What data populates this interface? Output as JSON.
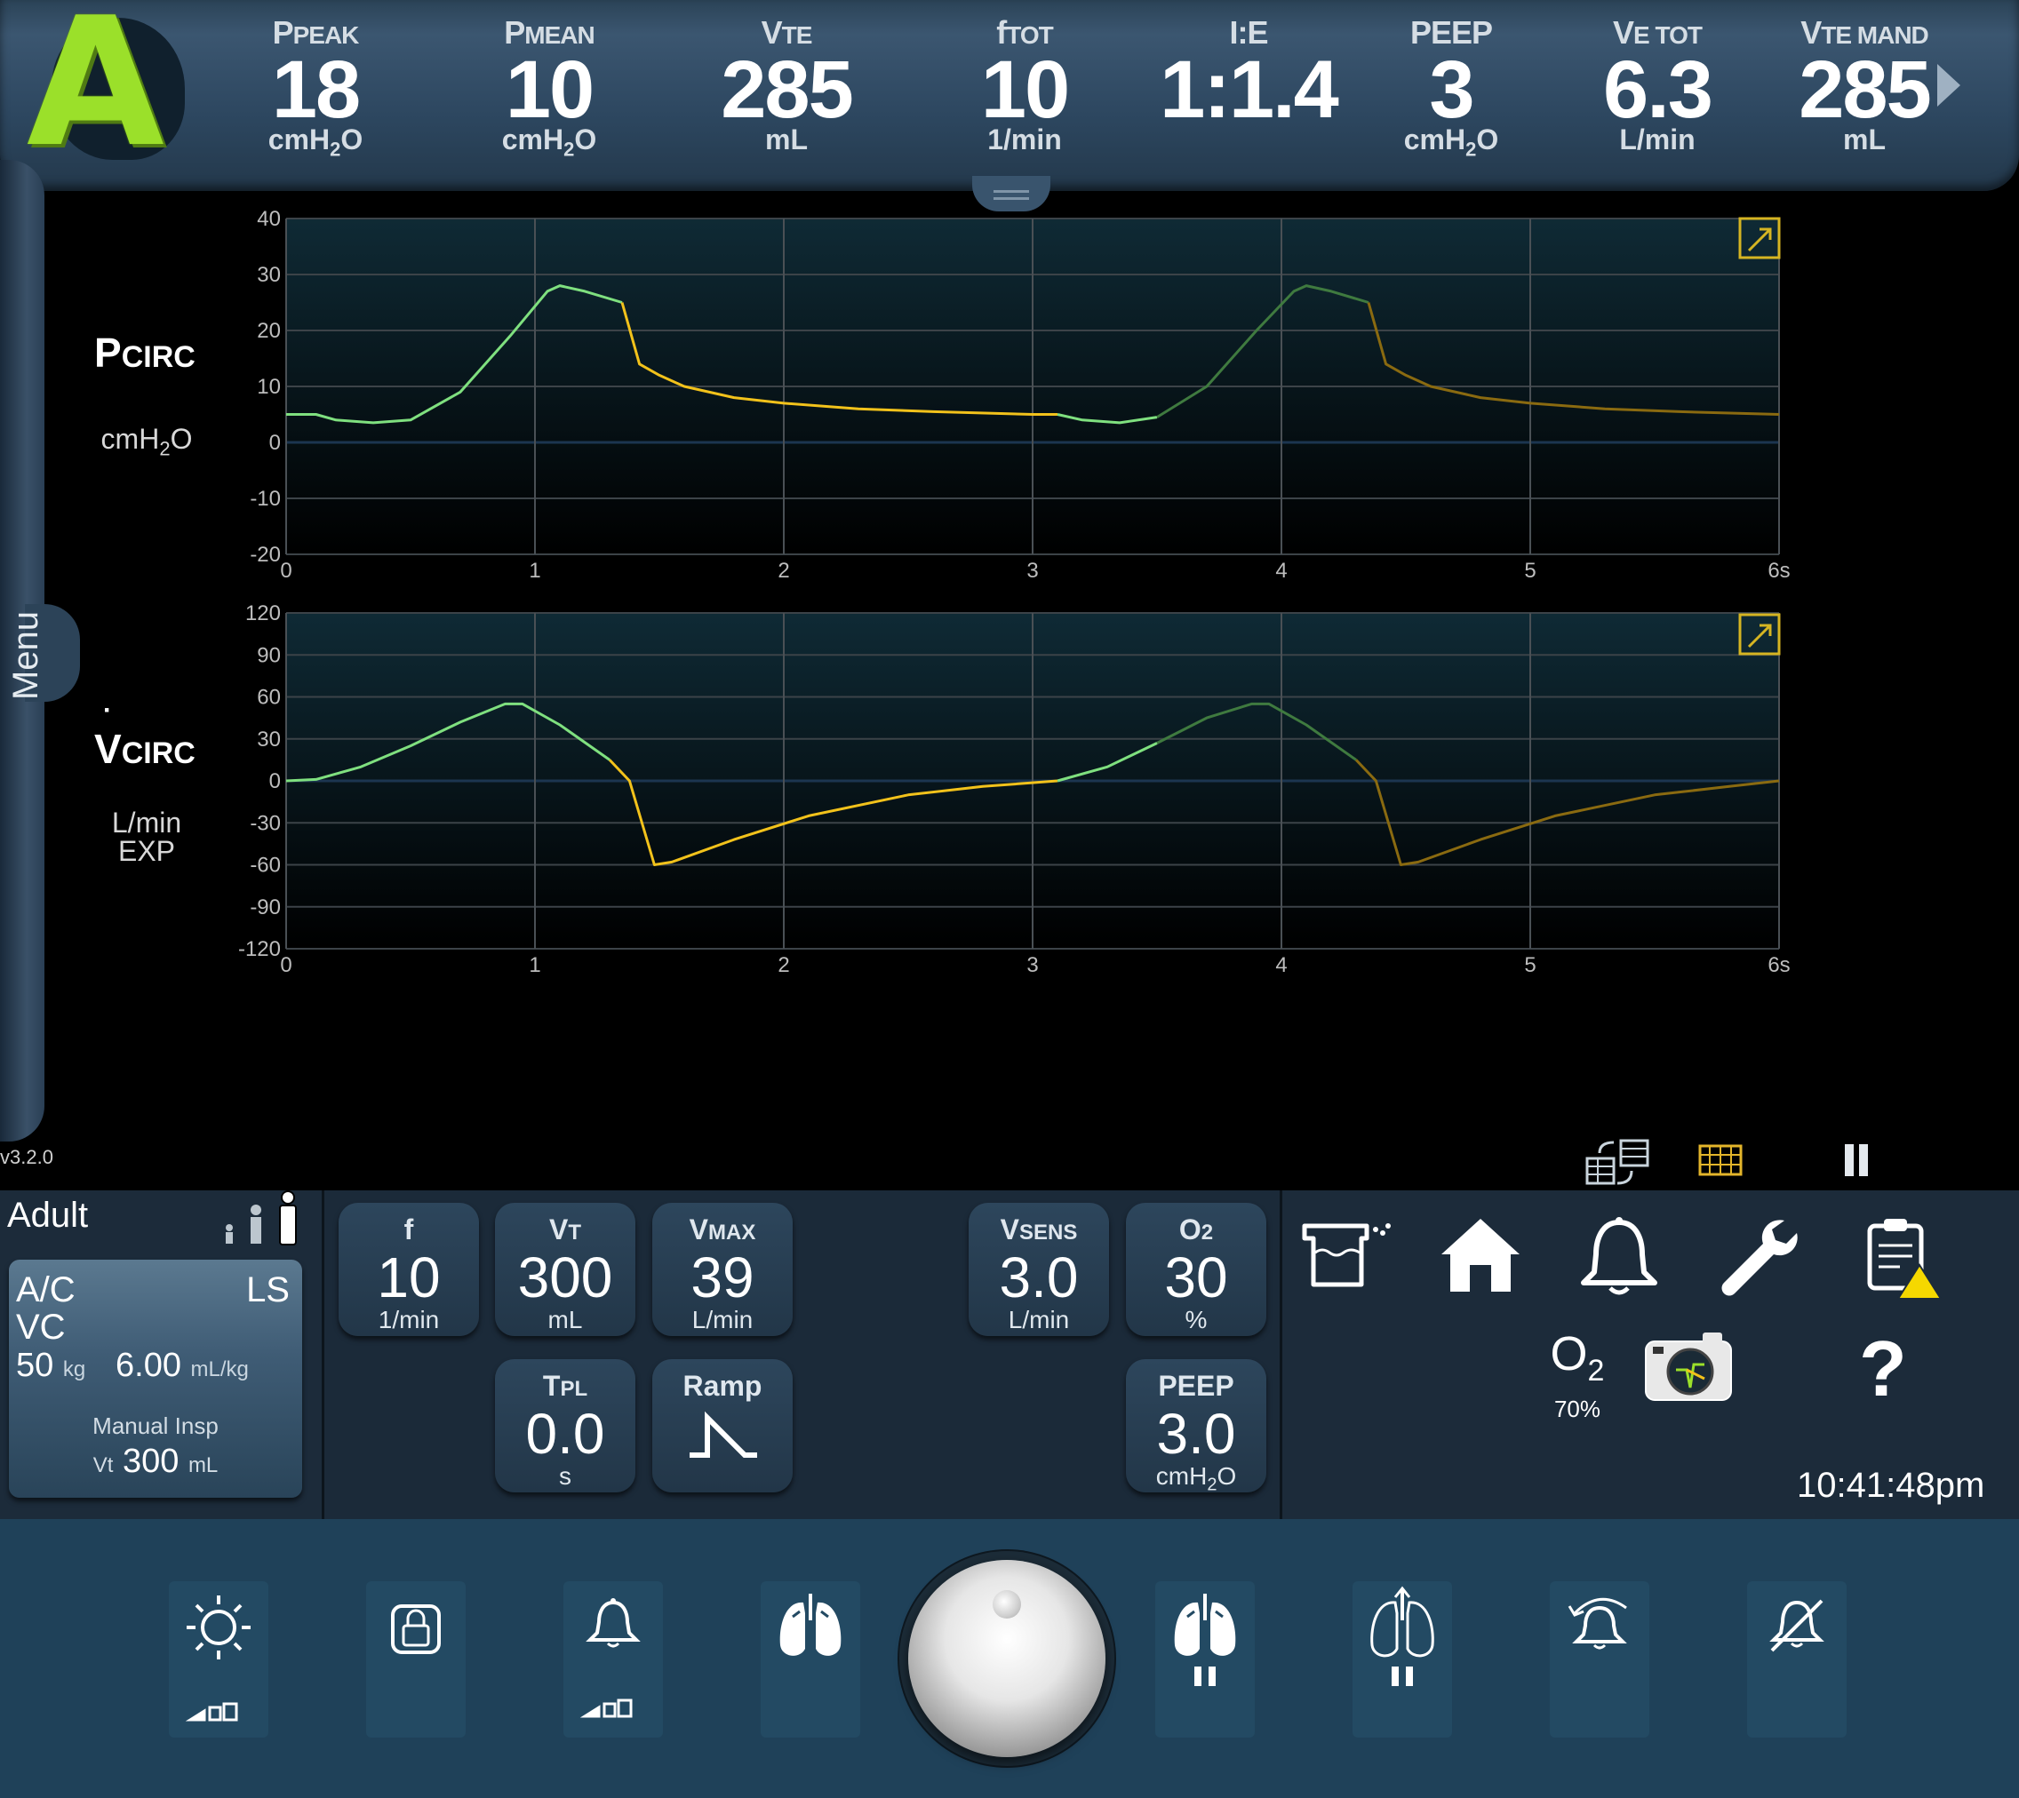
{
  "mode_letter": "A",
  "monitored": [
    {
      "main": "P",
      "sub": "PEAK",
      "value": "18",
      "unit": "cmH",
      "unit_sub": "2",
      "unit_tail": "O"
    },
    {
      "main": "P",
      "sub": "MEAN",
      "value": "10",
      "unit": "cmH",
      "unit_sub": "2",
      "unit_tail": "O"
    },
    {
      "main": "V",
      "sub": "TE",
      "value": "285",
      "unit": "mL",
      "unit_sub": "",
      "unit_tail": ""
    },
    {
      "main": "f",
      "sub": "TOT",
      "value": "10",
      "unit": "1/min",
      "unit_sub": "",
      "unit_tail": ""
    },
    {
      "main": "I:E",
      "sub": "",
      "value": "1:1.4",
      "unit": "",
      "unit_sub": "",
      "unit_tail": ""
    },
    {
      "main": "PEEP",
      "sub": "",
      "value": "3",
      "unit": "cmH",
      "unit_sub": "2",
      "unit_tail": "O"
    },
    {
      "main": "V",
      "sub": "E TOT",
      "value": "6.3",
      "unit": "L/min",
      "unit_sub": "",
      "unit_tail": ""
    },
    {
      "main": "V",
      "sub": "TE MAND",
      "value": "285",
      "unit": "mL",
      "unit_sub": "",
      "unit_tail": ""
    }
  ],
  "menu_label": "Menu",
  "version": "v3.2.0",
  "waveforms": {
    "pressure": {
      "label_main": "P",
      "label_sub": "CIRC",
      "unit_main": "cmH",
      "unit_sub": "2",
      "unit_tail": "O"
    },
    "flow": {
      "label_main": "V",
      "label_sub": "CIRC",
      "unit_line1": "L/min",
      "unit_line2": "EXP"
    }
  },
  "chart_data": [
    {
      "type": "line",
      "name": "pressure",
      "ylim": [
        -20,
        40
      ],
      "yticks": [
        "40",
        "30",
        "20",
        "10",
        "0",
        "-10",
        "-20"
      ],
      "xlim": [
        0,
        6
      ],
      "xticks": [
        "0",
        "1",
        "2",
        "3",
        "4",
        "5",
        "6s"
      ],
      "series": [
        {
          "phase": "insp",
          "x": [
            0,
            0.12,
            0.2,
            0.35,
            0.5,
            0.7,
            0.9,
            1.05,
            1.1,
            1.2,
            1.35
          ],
          "y": [
            5,
            5,
            4,
            3.5,
            4,
            9,
            19,
            27,
            28,
            27,
            25
          ]
        },
        {
          "phase": "exp",
          "x": [
            1.35,
            1.42,
            1.5,
            1.6,
            1.8,
            2.0,
            2.3,
            2.6,
            3.0,
            3.1
          ],
          "y": [
            25,
            14,
            12,
            10,
            8,
            7,
            6,
            5.5,
            5,
            5
          ]
        },
        {
          "phase": "insp",
          "x": [
            3.1,
            3.2,
            3.35,
            3.5
          ],
          "y": [
            5,
            4,
            3.5,
            4.5
          ]
        },
        {
          "phase": "insp_prev",
          "x": [
            3.5,
            3.7,
            3.9,
            4.05,
            4.1,
            4.2,
            4.35
          ],
          "y": [
            4.5,
            10,
            20,
            27,
            28,
            27,
            25
          ]
        },
        {
          "phase": "exp_prev",
          "x": [
            4.35,
            4.42,
            4.5,
            4.6,
            4.8,
            5.0,
            5.3,
            5.6,
            6.0
          ],
          "y": [
            25,
            14,
            12,
            10,
            8,
            7,
            6,
            5.5,
            5
          ]
        }
      ]
    },
    {
      "type": "line",
      "name": "flow",
      "ylim": [
        -120,
        120
      ],
      "yticks": [
        "120",
        "90",
        "60",
        "30",
        "0",
        "-30",
        "-60",
        "-90",
        "-120"
      ],
      "xlim": [
        0,
        6
      ],
      "xticks": [
        "0",
        "1",
        "2",
        "3",
        "4",
        "5",
        "6s"
      ],
      "series": [
        {
          "phase": "insp",
          "x": [
            0,
            0.12,
            0.3,
            0.5,
            0.7,
            0.88,
            0.95,
            1.1,
            1.3
          ],
          "y": [
            0,
            1,
            10,
            25,
            42,
            55,
            55,
            40,
            15
          ]
        },
        {
          "phase": "exp",
          "x": [
            1.3,
            1.38,
            1.48,
            1.55,
            1.8,
            2.1,
            2.5,
            2.8,
            3.1
          ],
          "y": [
            15,
            0,
            -60,
            -58,
            -42,
            -25,
            -10,
            -4,
            0
          ]
        },
        {
          "phase": "insp",
          "x": [
            3.1,
            3.3,
            3.5
          ],
          "y": [
            0,
            10,
            27
          ]
        },
        {
          "phase": "insp_prev",
          "x": [
            3.5,
            3.7,
            3.88,
            3.95,
            4.1,
            4.3
          ],
          "y": [
            27,
            45,
            55,
            55,
            40,
            15
          ]
        },
        {
          "phase": "exp_prev",
          "x": [
            4.3,
            4.38,
            4.48,
            4.55,
            4.8,
            5.1,
            5.5,
            5.8,
            6.0
          ],
          "y": [
            15,
            0,
            -60,
            -58,
            -42,
            -25,
            -10,
            -4,
            0
          ]
        }
      ]
    }
  ],
  "patient": {
    "type": "Adult"
  },
  "mode_card": {
    "mode": "A/C",
    "control": "VC",
    "trigger": "LS",
    "weight": "50",
    "weight_unit": "kg",
    "vt_per_kg": "6.00",
    "vt_per_kg_unit": "mL/kg",
    "manual_label": "Manual Insp",
    "manual_vt_label": "Vt",
    "manual_vt": "300",
    "manual_vt_unit": "mL"
  },
  "settings": [
    {
      "main": "f",
      "sub": "",
      "value": "10",
      "unit": "1/min"
    },
    {
      "main": "V",
      "sub": "T",
      "value": "300",
      "unit": "mL"
    },
    {
      "main": "V",
      "sub": "MAX",
      "value": "39",
      "unit": "L/min"
    },
    {
      "main": "V",
      "sub": "SENS",
      "value": "3.0",
      "unit": "L/min"
    },
    {
      "main": "O",
      "sub": "2",
      "value": "30",
      "unit": "%"
    },
    {
      "main": "T",
      "sub": "PL",
      "value": "0.0",
      "unit": "s"
    },
    {
      "main": "Ramp",
      "sub": "",
      "value": "",
      "unit": ""
    },
    {
      "main": "PEEP",
      "sub": "",
      "value": "3.0",
      "unit": "cmH2O"
    }
  ],
  "o2_status": {
    "label": "O",
    "sub": "2",
    "value": "70%"
  },
  "help_label": "?",
  "clock": "10:41:48pm",
  "colors": {
    "insp": "#7fe07f",
    "exp": "#f2c21b",
    "insp_prev": "#3f7a3f",
    "exp_prev": "#8a6a10",
    "accent_green": "#9be02a",
    "alert_yellow": "#f5d800"
  }
}
